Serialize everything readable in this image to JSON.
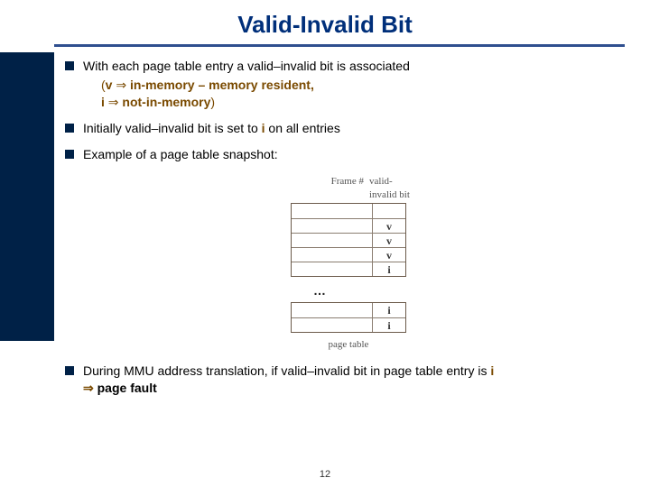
{
  "title": "Valid-Invalid Bit",
  "bullets": {
    "b1": {
      "lead": "With each page table entry a valid–invalid bit is associated",
      "line2a": "(",
      "line2b_v": "v",
      "line2c_arrow": " ⇒ ",
      "line2d": "in-memory – memory resident,",
      "line3a_i": " i",
      "line3b_arrow": " ⇒ ",
      "line3c": "not-in-memory",
      "line3d_paren": ")"
    },
    "b2a": "Initially valid–invalid bit is set to ",
    "b2b_i": "i",
    "b2c": " on all entries",
    "b3": "Example of a page table snapshot:",
    "b4a": "During MMU address translation, if valid–invalid bit in page table entry is ",
    "b4b_i": "i",
    "b4c_arrow": "⇒ ",
    "b4d": "page fault"
  },
  "diagram": {
    "hdr_frame": "Frame #",
    "hdr_bit": "valid-invalid bit",
    "rows_top": [
      "",
      "v",
      "v",
      "v",
      "i"
    ],
    "dots": "…",
    "rows_bot": [
      "i",
      "i"
    ],
    "caption": "page table"
  },
  "slidenum": "12"
}
